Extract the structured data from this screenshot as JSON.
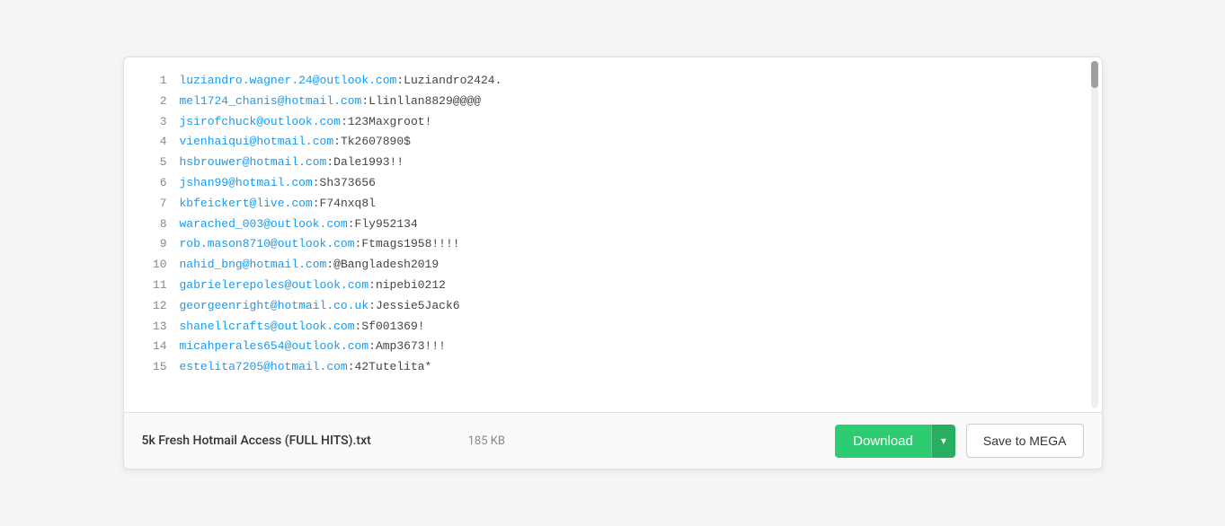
{
  "file": {
    "name": "5k Fresh Hotmail Access (FULL HITS).txt",
    "size": "185 KB"
  },
  "buttons": {
    "download": "Download",
    "save_mega": "Save to MEGA",
    "arrow": "▾"
  },
  "lines": [
    {
      "num": 1,
      "email": "luziandro.wagner.24@outlook.com",
      "sep": ":",
      "password": "Luziandro2424."
    },
    {
      "num": 2,
      "email": "mel1724_chanis@hotmail.com",
      "sep": ":",
      "password": "Llinllan8829@@@@"
    },
    {
      "num": 3,
      "email": "jsirofchuck@outlook.com",
      "sep": ":",
      "password": "123Maxgroot!"
    },
    {
      "num": 4,
      "email": "vienhaiqui@hotmail.com",
      "sep": ":",
      "password": "Tk2607890$"
    },
    {
      "num": 5,
      "email": "hsbrouwer@hotmail.com",
      "sep": ":",
      "password": "Dale1993!!"
    },
    {
      "num": 6,
      "email": "jshan99@hotmail.com",
      "sep": ":",
      "password": "Sh373656"
    },
    {
      "num": 7,
      "email": "kbfeickert@live.com",
      "sep": ":",
      "password": "F74nxq8l"
    },
    {
      "num": 8,
      "email": "warached_003@outlook.com",
      "sep": ":",
      "password": "Fly952134"
    },
    {
      "num": 9,
      "email": "rob.mason8710@outlook.com",
      "sep": ":",
      "password": "Ftmags1958!!!!"
    },
    {
      "num": 10,
      "email": "nahid_bng@hotmail.com",
      "sep": ":",
      "password": "@Bangladesh2019"
    },
    {
      "num": 11,
      "email": "gabrielerepoles@outlook.com",
      "sep": ":",
      "password": "nipebi0212"
    },
    {
      "num": 12,
      "email": "georgeenright@hotmail.co.uk",
      "sep": ":",
      "password": "Jessie5Jack6"
    },
    {
      "num": 13,
      "email": "shanellcrafts@outlook.com",
      "sep": ":",
      "password": "Sf001369!"
    },
    {
      "num": 14,
      "email": "micahperales654@outlook.com",
      "sep": ":",
      "password": "Amp3673!!!"
    },
    {
      "num": 15,
      "email": "estelita7205@hotmail.com",
      "sep": ":",
      "password": "42Tutelita*"
    }
  ]
}
